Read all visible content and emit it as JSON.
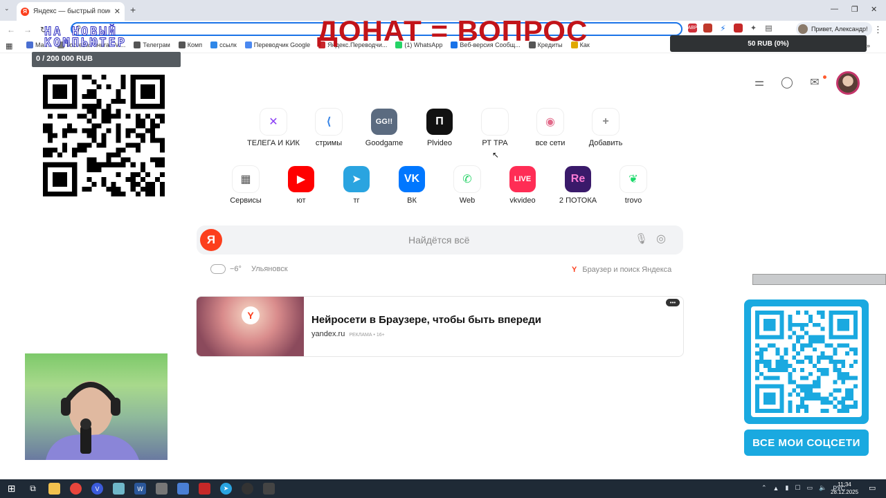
{
  "browser": {
    "tab_title": "Яндекс — быстрый поиск в интернете",
    "tab_close": "✕",
    "new_tab": "+",
    "address_text": "",
    "profile_label": "Привет, Александр!",
    "bookmarks": [
      {
        "label": "Ма...",
        "color": "#4a6fd1"
      },
      {
        "label": "Гостевая книга - Vi...",
        "color": "#7a7a7a"
      },
      {
        "label": "Телеграм",
        "color": "#555"
      },
      {
        "label": "Комп",
        "color": "#555"
      },
      {
        "label": "ссылк",
        "color": "#2f87e8"
      },
      {
        "label": "Переводчик Google",
        "color": "#4a88f0"
      },
      {
        "label": "Яндекс.Переводчи...",
        "color": "#c8272c"
      },
      {
        "label": "(1) WhatsApp",
        "color": "#25d366"
      },
      {
        "label": "Веб-версия Сообщ...",
        "color": "#1a73e8"
      },
      {
        "label": "Кредиты",
        "color": "#555"
      },
      {
        "label": "Как",
        "color": "#e0a800"
      }
    ],
    "bookmarks_more": "»"
  },
  "overlay": {
    "donat_text": "ДОНАТ = ВОПРОС",
    "channel_logo_line1": "НА НОВЫЙ",
    "channel_logo_line2": "КОМПЬЮТЕР",
    "goal_text": "0 / 200 000 RUB",
    "donation_text": "50 RUB (0%)",
    "social_button": "ВСЕ МОИ СОЦСЕТИ"
  },
  "shortcuts_row1": [
    {
      "label": "ТЕЛЕГА И КИК",
      "glyph": "✕",
      "bg": "#ffffff",
      "fg": "#8b3ff5"
    },
    {
      "label": "стримы",
      "glyph": "⟨",
      "bg": "#ffffff",
      "fg": "#3a86e6"
    },
    {
      "label": "Goodgame",
      "glyph": "GG!!",
      "bg": "#5b6b80",
      "fg": "#ffffff"
    },
    {
      "label": "Plvideo",
      "glyph": "П",
      "bg": "#111111",
      "fg": "#ffffff"
    },
    {
      "label": "РТ ТРА",
      "glyph": "",
      "bg": "#ffffff",
      "fg": "#cccccc"
    },
    {
      "label": "все сети",
      "glyph": "◉",
      "bg": "#ffffff",
      "fg": "#e26a8a"
    },
    {
      "label": "Добавить",
      "glyph": "+",
      "bg": "#ffffff",
      "fg": "#888888"
    }
  ],
  "shortcuts_row2": [
    {
      "label": "Сервисы",
      "glyph": "▦",
      "bg": "#ffffff",
      "fg": "#555555"
    },
    {
      "label": "ют",
      "glyph": "▶",
      "bg": "#ff0000",
      "fg": "#ffffff"
    },
    {
      "label": "тг",
      "glyph": "➤",
      "bg": "#2aa4e0",
      "fg": "#ffffff"
    },
    {
      "label": "ВК",
      "glyph": "VK",
      "bg": "#0077ff",
      "fg": "#ffffff"
    },
    {
      "label": "Web",
      "glyph": "✆",
      "bg": "#ffffff",
      "fg": "#25d366"
    },
    {
      "label": "vkvideo",
      "glyph": "LIVE",
      "bg": "#ff2d55",
      "fg": "#ffffff"
    },
    {
      "label": "2 ПОТОКА",
      "glyph": "Re",
      "bg": "#3a1a6a",
      "fg": "#ff7bd5"
    },
    {
      "label": "trovo",
      "glyph": "❦",
      "bg": "#ffffff",
      "fg": "#1bd96a"
    }
  ],
  "search": {
    "placeholder": "Найдётся всё",
    "logo": "Я"
  },
  "weather": {
    "temp": "−6°",
    "city": "Ульяновск"
  },
  "promo": {
    "text": "Браузер и поиск Яндекса",
    "logo": "Y"
  },
  "ad": {
    "title": "Нейросети в Браузере, чтобы быть впереди",
    "domain": "yandex.ru",
    "label": "РЕКЛАМА • 16+",
    "more": "•••",
    "logo": "Y"
  },
  "taskbar": {
    "lang": "РУС",
    "time": "11:34",
    "date": "28.12.2025"
  },
  "colors": {
    "yandex_red": "#fc3f1d",
    "donat_red": "#c2141a",
    "social_blue": "#1aa9e0"
  }
}
